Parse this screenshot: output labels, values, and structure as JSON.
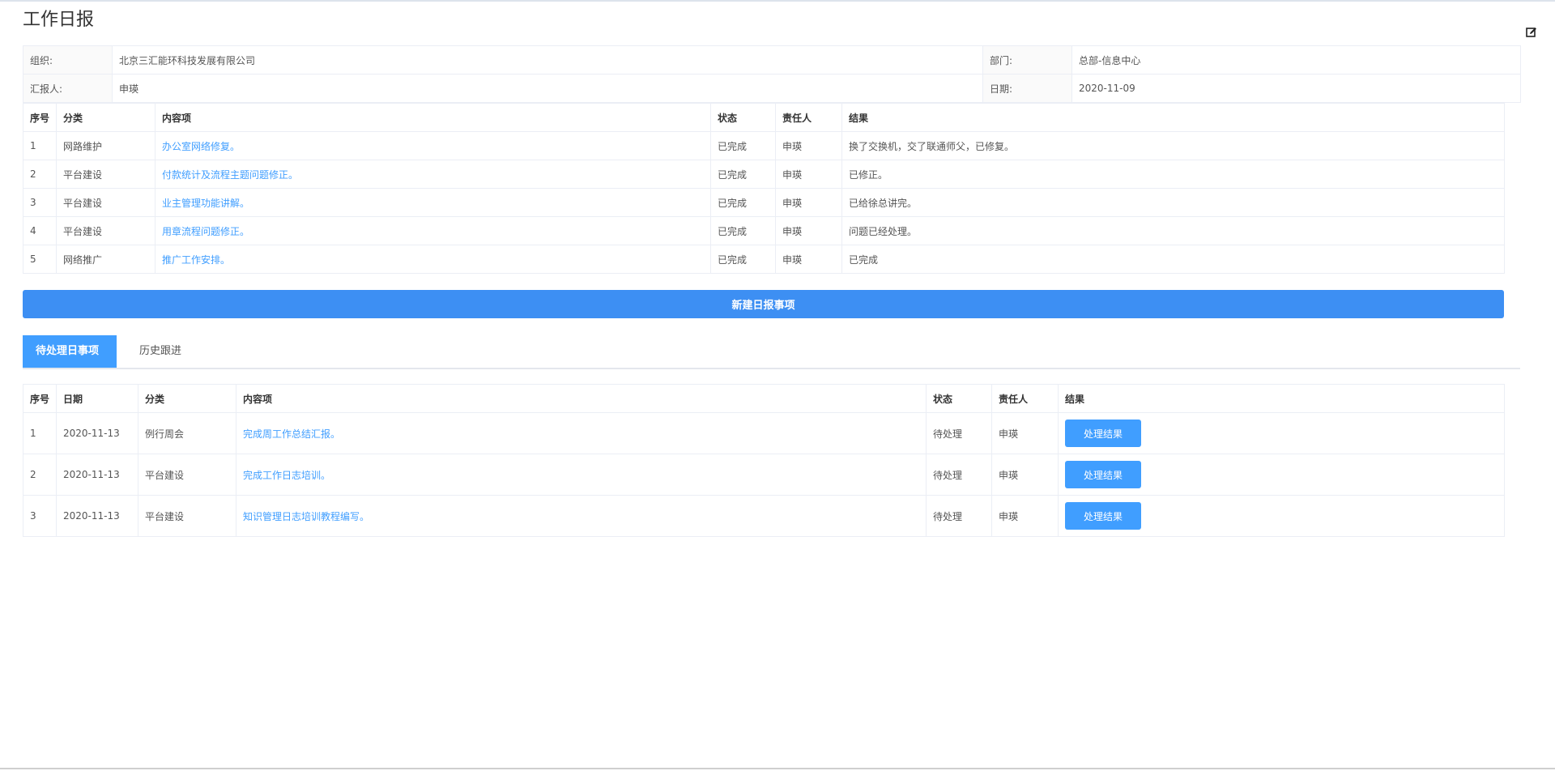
{
  "page": {
    "title": "工作日报"
  },
  "info": {
    "org_label": "组织:",
    "org_value": "北京三汇能环科技发展有限公司",
    "dept_label": "部门:",
    "dept_value": "总部-信息中心",
    "reporter_label": "汇报人:",
    "reporter_value": "申瑛",
    "date_label": "日期:",
    "date_value": "2020-11-09"
  },
  "items": {
    "headers": [
      "序号",
      "分类",
      "内容项",
      "状态",
      "责任人",
      "结果"
    ],
    "rows": [
      {
        "no": "1",
        "category": "网路维护",
        "content": "办公室网络修复。",
        "status": "已完成",
        "owner": "申瑛",
        "result": "换了交换机，交了联通师父，已修复。"
      },
      {
        "no": "2",
        "category": "平台建设",
        "content": "付款统计及流程主题问题修正。",
        "status": "已完成",
        "owner": "申瑛",
        "result": "已修正。"
      },
      {
        "no": "3",
        "category": "平台建设",
        "content": "业主管理功能讲解。",
        "status": "已完成",
        "owner": "申瑛",
        "result": "已给徐总讲完。"
      },
      {
        "no": "4",
        "category": "平台建设",
        "content": "用章流程问题修正。",
        "status": "已完成",
        "owner": "申瑛",
        "result": "问题已经处理。"
      },
      {
        "no": "5",
        "category": "网络推广",
        "content": "推广工作安排。",
        "status": "已完成",
        "owner": "申瑛",
        "result": "已完成"
      }
    ]
  },
  "actions": {
    "new_item_label": "新建日报事项"
  },
  "tabs": [
    {
      "label": "待处理日事项",
      "active": true
    },
    {
      "label": "历史跟进",
      "active": false
    }
  ],
  "pending": {
    "headers": [
      "序号",
      "日期",
      "分类",
      "内容项",
      "状态",
      "责任人",
      "结果"
    ],
    "button_label": "处理结果",
    "rows": [
      {
        "no": "1",
        "date": "2020-11-13",
        "category": "例行周会",
        "content": "完成周工作总结汇报。",
        "status": "待处理",
        "owner": "申瑛"
      },
      {
        "no": "2",
        "date": "2020-11-13",
        "category": "平台建设",
        "content": "完成工作日志培训。",
        "status": "待处理",
        "owner": "申瑛"
      },
      {
        "no": "3",
        "date": "2020-11-13",
        "category": "平台建设",
        "content": "知识管理日志培训教程编写。",
        "status": "待处理",
        "owner": "申瑛"
      }
    ]
  },
  "colors": {
    "accent": "#409eff",
    "new_button": "#3d8ff3",
    "border": "#ebeef5"
  },
  "icons": {
    "edit": "edit-icon"
  }
}
